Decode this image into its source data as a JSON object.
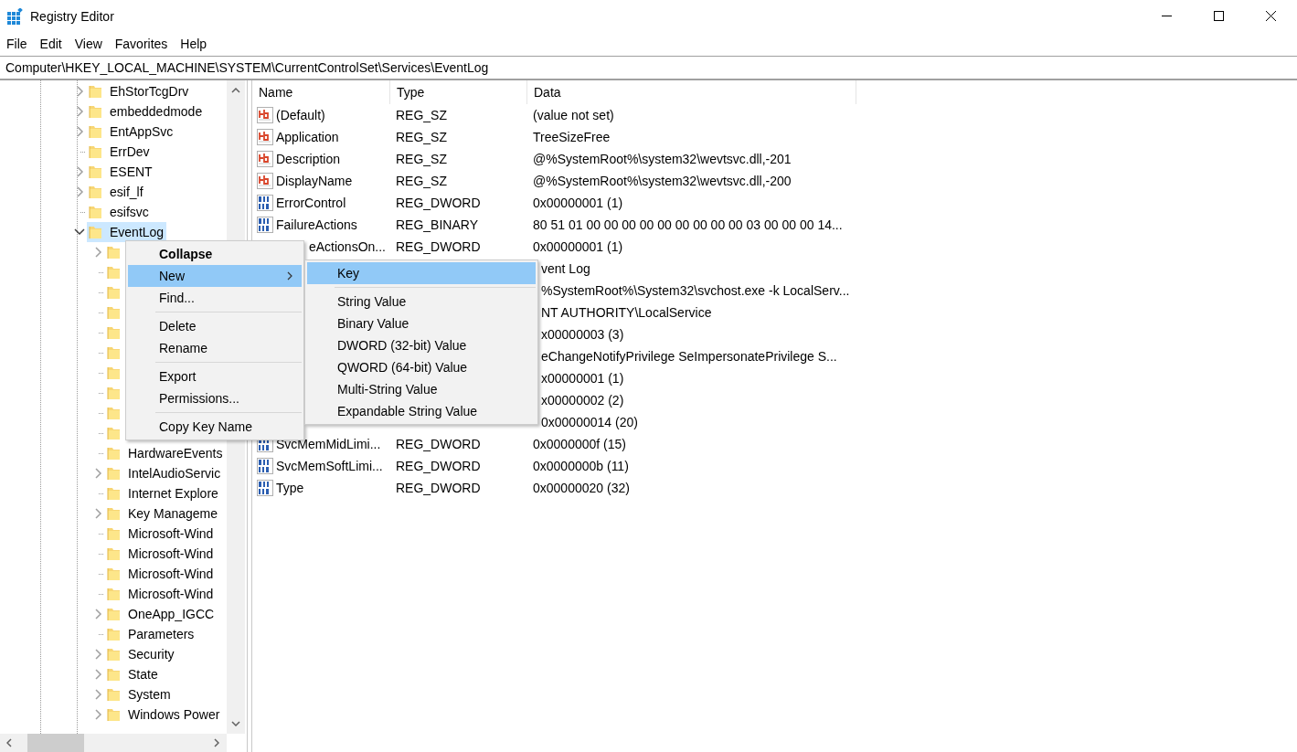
{
  "window": {
    "title": "Registry Editor"
  },
  "menu_bar": [
    "File",
    "Edit",
    "View",
    "Favorites",
    "Help"
  ],
  "address": "Computer\\HKEY_LOCAL_MACHINE\\SYSTEM\\CurrentControlSet\\Services\\EventLog",
  "tree": {
    "items": [
      {
        "label": "EhStorTcgDrv",
        "expandable": true,
        "expanded": false,
        "selected": false
      },
      {
        "label": "embeddedmode",
        "expandable": true,
        "expanded": false,
        "selected": false
      },
      {
        "label": "EntAppSvc",
        "expandable": true,
        "expanded": false,
        "selected": false
      },
      {
        "label": "ErrDev",
        "expandable": false,
        "selected": false
      },
      {
        "label": "ESENT",
        "expandable": true,
        "expanded": false,
        "selected": false
      },
      {
        "label": "esif_lf",
        "expandable": true,
        "expanded": false,
        "selected": false
      },
      {
        "label": "esifsvc",
        "expandable": false,
        "selected": false
      },
      {
        "label": "EventLog",
        "expandable": true,
        "expanded": true,
        "selected": true,
        "children": [
          {
            "expandable": true,
            "expanded": false,
            "selected": false
          },
          {
            "expandable": false,
            "selected": false
          },
          {
            "expandable": false,
            "selected": false
          },
          {
            "expandable": false,
            "selected": false
          },
          {
            "expandable": false,
            "selected": false
          },
          {
            "expandable": false,
            "selected": false
          },
          {
            "expandable": false,
            "selected": false
          },
          {
            "expandable": false,
            "selected": false
          },
          {
            "expandable": false,
            "selected": false
          },
          {
            "expandable": false,
            "selected": false
          },
          {
            "label": "HardwareEvents",
            "expandable": false,
            "selected": false
          },
          {
            "label": "IntelAudioServic",
            "expandable": true,
            "expanded": false,
            "selected": false
          },
          {
            "label": "Internet Explore",
            "expandable": false,
            "selected": false
          },
          {
            "label": "Key Manageme",
            "expandable": true,
            "expanded": false,
            "selected": false
          },
          {
            "label": "Microsoft-Wind",
            "expandable": false,
            "selected": false
          },
          {
            "label": "Microsoft-Wind",
            "expandable": false,
            "selected": false
          },
          {
            "label": "Microsoft-Wind",
            "expandable": false,
            "selected": false
          },
          {
            "label": "Microsoft-Wind",
            "expandable": false,
            "selected": false
          },
          {
            "label": "OneApp_IGCC",
            "expandable": true,
            "expanded": false,
            "selected": false
          },
          {
            "label": "Parameters",
            "expandable": false,
            "selected": false
          },
          {
            "label": "Security",
            "expandable": true,
            "expanded": false,
            "selected": false
          },
          {
            "label": "State",
            "expandable": true,
            "expanded": false,
            "selected": false
          },
          {
            "label": "System",
            "expandable": true,
            "expanded": false,
            "selected": false
          },
          {
            "label": "Windows Power",
            "expandable": true,
            "expanded": false,
            "selected": false
          }
        ]
      }
    ]
  },
  "values": {
    "columns": [
      "Name",
      "Type",
      "Data"
    ],
    "rows": [
      {
        "kind": "string",
        "name": "(Default)",
        "type": "REG_SZ",
        "data": "(value not set)"
      },
      {
        "kind": "string",
        "name": "Application",
        "type": "REG_SZ",
        "data": "TreeSizeFree"
      },
      {
        "kind": "string",
        "name": "Description",
        "type": "REG_SZ",
        "data": "@%SystemRoot%\\system32\\wevtsvc.dll,-201"
      },
      {
        "kind": "string",
        "name": "DisplayName",
        "type": "REG_SZ",
        "data": "@%SystemRoot%\\system32\\wevtsvc.dll,-200"
      },
      {
        "kind": "binary",
        "name": "ErrorControl",
        "type": "REG_DWORD",
        "data": "0x00000001 (1)"
      },
      {
        "kind": "binary",
        "name": "FailureActions",
        "type": "REG_BINARY",
        "data": "80 51 01 00 00 00 00 00 00 00 00 00 03 00 00 00 14..."
      },
      {
        "name": "eActionsOn...",
        "type": "REG_DWORD",
        "data": "0x00000001 (1)"
      },
      {
        "data": "vent Log"
      },
      {
        "data": "%SystemRoot%\\System32\\svchost.exe -k LocalServ..."
      },
      {
        "data": "NT AUTHORITY\\LocalService"
      },
      {
        "data": "x00000003 (3)"
      },
      {
        "data": "eChangeNotifyPrivilege SeImpersonatePrivilege S..."
      },
      {
        "data": "x00000001 (1)"
      },
      {
        "data": "x00000002 (2)"
      },
      {
        "data": "0x00000014 (20)"
      },
      {
        "kind": "binary",
        "name": "SvcMemMidLimi...",
        "type": "REG_DWORD",
        "data": "0x0000000f (15)"
      },
      {
        "kind": "binary",
        "name": "SvcMemSoftLimi...",
        "type": "REG_DWORD",
        "data": "0x0000000b (11)"
      },
      {
        "kind": "binary",
        "name": "Type",
        "type": "REG_DWORD",
        "data": "0x00000020 (32)"
      }
    ]
  },
  "context_menu": {
    "items": [
      {
        "kind": "default",
        "label": "Collapse",
        "selected": false
      },
      {
        "kind": "item",
        "label": "New",
        "selected": true,
        "has_submenu": true
      },
      {
        "kind": "item",
        "label": "Find...",
        "selected": false
      },
      {
        "kind": "separator"
      },
      {
        "kind": "item",
        "label": "Delete",
        "selected": false
      },
      {
        "kind": "item",
        "label": "Rename",
        "selected": false
      },
      {
        "kind": "separator"
      },
      {
        "kind": "item",
        "label": "Export",
        "selected": false
      },
      {
        "kind": "item",
        "label": "Permissions...",
        "selected": false
      },
      {
        "kind": "separator"
      },
      {
        "kind": "item",
        "label": "Copy Key Name",
        "selected": false
      }
    ]
  },
  "submenu": {
    "items": [
      {
        "kind": "item",
        "label": "Key",
        "selected": true
      },
      {
        "kind": "separator"
      },
      {
        "kind": "item",
        "label": "String Value",
        "selected": false
      },
      {
        "kind": "item",
        "label": "Binary Value",
        "selected": false
      },
      {
        "kind": "item",
        "label": "DWORD (32-bit) Value",
        "selected": false
      },
      {
        "kind": "item",
        "label": "QWORD (64-bit) Value",
        "selected": false
      },
      {
        "kind": "item",
        "label": "Multi-String Value",
        "selected": false
      },
      {
        "kind": "item",
        "label": "Expandable String Value",
        "selected": false
      }
    ]
  }
}
